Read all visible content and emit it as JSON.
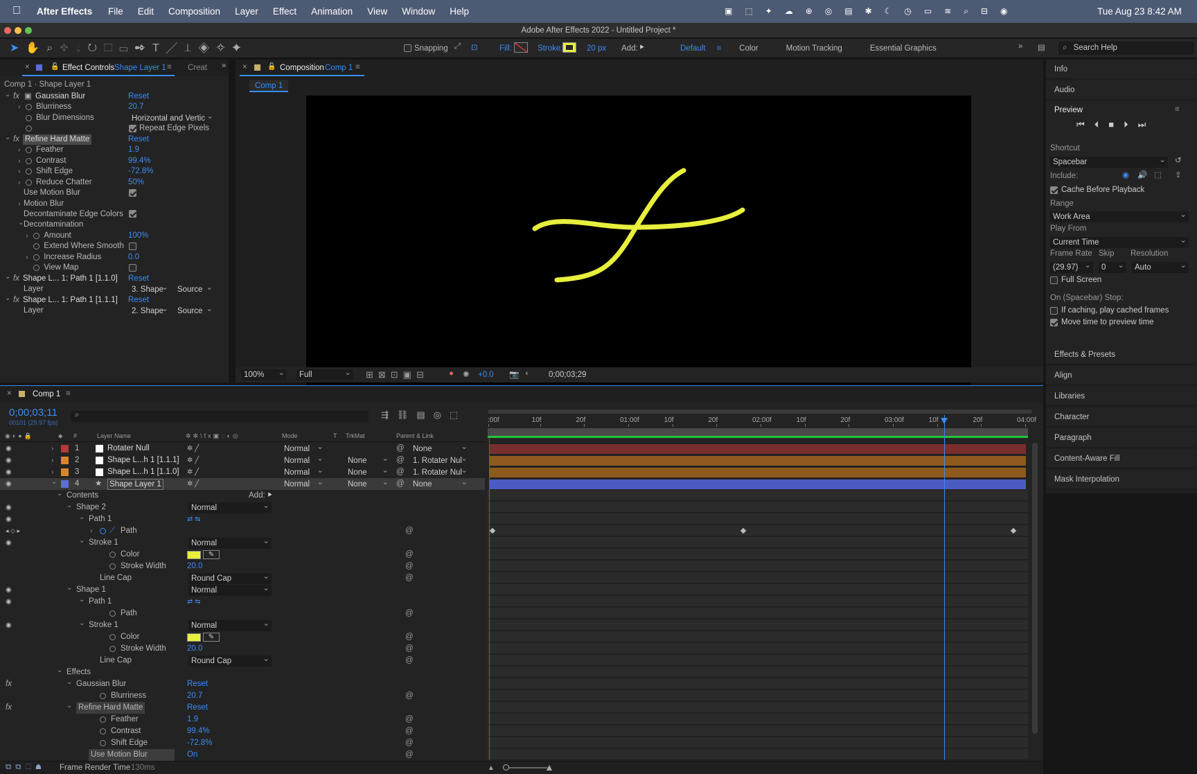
{
  "menubar": {
    "app": "After Effects",
    "items": [
      "File",
      "Edit",
      "Composition",
      "Layer",
      "Effect",
      "Animation",
      "View",
      "Window",
      "Help"
    ],
    "clock": "Tue Aug 23  8:42 AM"
  },
  "window": {
    "title": "Adobe After Effects 2022 - Untitled Project *"
  },
  "toolbar": {
    "snapping": "Snapping",
    "fill": "Fill:",
    "stroke": "Stroke:",
    "stroke_px": "20 px",
    "add": "Add:",
    "workspaces": [
      "Default",
      "Color",
      "Motion Tracking",
      "Essential Graphics"
    ],
    "search": "Search Help"
  },
  "effect_controls": {
    "tab_prefix": "Effect Controls",
    "tab_layer": "Shape Layer 1",
    "tab2": "Creat",
    "header": "Comp 1 · Shape Layer 1",
    "rows": [
      {
        "l": "Gaussian Blur",
        "v": "Reset",
        "t": "fx",
        "i": 0
      },
      {
        "l": "Blurriness",
        "v": "20.7",
        "t": "p",
        "i": 1
      },
      {
        "l": "Blur Dimensions",
        "v": "Horizontal and Vertic",
        "t": "dd",
        "i": 1
      },
      {
        "l": "",
        "v": "Repeat Edge Pixels",
        "t": "cb",
        "i": 1
      },
      {
        "l": "Refine Hard Matte",
        "v": "Reset",
        "t": "fx",
        "i": 0,
        "sel": true
      },
      {
        "l": "Feather",
        "v": "1.9",
        "t": "p",
        "i": 1
      },
      {
        "l": "Contrast",
        "v": "99.4%",
        "t": "p",
        "i": 1
      },
      {
        "l": "Shift Edge",
        "v": "-72.8%",
        "t": "p",
        "i": 1
      },
      {
        "l": "Reduce Chatter",
        "v": "50%",
        "t": "p",
        "i": 1
      },
      {
        "l": "Use Motion Blur",
        "v": "",
        "t": "cb",
        "i": 2
      },
      {
        "l": "Motion Blur",
        "v": "",
        "t": "grp",
        "i": 1
      },
      {
        "l": "Decontaminate Edge Colors",
        "v": "",
        "t": "cb",
        "i": 2
      },
      {
        "l": "Decontamination",
        "v": "",
        "t": "grp",
        "i": 1,
        "open": true
      },
      {
        "l": "Amount",
        "v": "100%",
        "t": "p",
        "i": 2
      },
      {
        "l": "Extend Where Smooth",
        "v": "",
        "t": "cbo",
        "i": 2
      },
      {
        "l": "Increase Radius",
        "v": "0.0",
        "t": "p",
        "i": 2
      },
      {
        "l": "View Map",
        "v": "",
        "t": "cbo",
        "i": 2
      },
      {
        "l": "Shape L... 1: Path 1 [1.1.0]",
        "v": "Reset",
        "t": "fx",
        "i": 0
      },
      {
        "l": "Layer",
        "v": "3. Shape",
        "t": "layer",
        "i": 2,
        "src": "Source"
      },
      {
        "l": "Shape L... 1: Path 1 [1.1.1]",
        "v": "Reset",
        "t": "fx",
        "i": 0
      },
      {
        "l": "Layer",
        "v": "2. Shape",
        "t": "layer",
        "i": 2,
        "src": "Source"
      }
    ]
  },
  "composition": {
    "tab_prefix": "Composition",
    "tab_comp": "Comp 1",
    "subtab": "Comp 1",
    "zoom": "100%",
    "quality": "Full",
    "exposure": "+0.0",
    "timecode": "0;00;03;29"
  },
  "right_panel": {
    "info": "Info",
    "audio": "Audio",
    "preview": "Preview",
    "shortcut_label": "Shortcut",
    "shortcut": "Spacebar",
    "include": "Include:",
    "cache": "Cache Before Playback",
    "range_label": "Range",
    "range": "Work Area",
    "playfrom_label": "Play From",
    "playfrom": "Current Time",
    "framerate_label": "Frame Rate",
    "skip_label": "Skip",
    "resolution_label": "Resolution",
    "framerate": "(29.97)",
    "skip": "0",
    "resolution": "Auto",
    "fullscreen": "Full Screen",
    "onstop": "On (Spacebar) Stop:",
    "ifcaching": "If caching, play cached frames",
    "movetime": "Move time to preview time",
    "panels": [
      "Effects & Presets",
      "Align",
      "Libraries",
      "Character",
      "Paragraph",
      "Content-Aware Fill",
      "Mask Interpolation"
    ]
  },
  "timeline": {
    "tab": "Comp 1",
    "timecode": "0;00;03;11",
    "frames": "00101 (29.97 fps)",
    "col_labels": {
      "layer_name": "Layer Name",
      "mode": "Mode",
      "t": "T",
      "trkmat": "TrkMat",
      "parent": "Parent & Link",
      "num": "#"
    },
    "ruler": [
      ":00f",
      "10f",
      "20f",
      "01:00f",
      "10f",
      "20f",
      "02:00f",
      "10f",
      "20f",
      "03:00f",
      "10f",
      "20f",
      "04:00f"
    ],
    "layers": [
      {
        "num": "1",
        "name": "Rotater Null",
        "mode": "Normal",
        "trk": "",
        "parent": "None",
        "color": "#b33a36",
        "bar": "#7a2f2f"
      },
      {
        "num": "2",
        "name": "Shape L...h 1 [1.1.1]",
        "mode": "Normal",
        "trk": "None",
        "parent": "1. Rotater Nul",
        "color": "#d9862a",
        "bar": "#8f5a1e"
      },
      {
        "num": "3",
        "name": "Shape L...h 1 [1.1.0]",
        "mode": "Normal",
        "trk": "None",
        "parent": "1. Rotater Nul",
        "color": "#d9862a",
        "bar": "#8f5a1e"
      },
      {
        "num": "4",
        "name": "Shape Layer 1",
        "mode": "Normal",
        "trk": "None",
        "parent": "None",
        "color": "#5b6ed8",
        "bar": "#4b5bc4"
      }
    ],
    "props": [
      {
        "l": "Contents",
        "i": 0,
        "x": "Add:"
      },
      {
        "l": "Shape 2",
        "i": 1,
        "m": "Normal"
      },
      {
        "l": "Path 1",
        "i": 2
      },
      {
        "l": "Path",
        "i": 3,
        "key": true
      },
      {
        "l": "Stroke 1",
        "i": 2,
        "m": "Normal"
      },
      {
        "l": "Color",
        "i": 4,
        "sw": true
      },
      {
        "l": "Stroke Width",
        "i": 4,
        "v": "20.0"
      },
      {
        "l": "Line Cap",
        "i": 3,
        "m": "Round Cap"
      },
      {
        "l": "Shape 1",
        "i": 1,
        "m": "Normal"
      },
      {
        "l": "Path 1",
        "i": 2
      },
      {
        "l": "Path",
        "i": 4
      },
      {
        "l": "Stroke 1",
        "i": 2,
        "m": "Normal"
      },
      {
        "l": "Color",
        "i": 4,
        "sw": true
      },
      {
        "l": "Stroke Width",
        "i": 4,
        "v": "20.0"
      },
      {
        "l": "Line Cap",
        "i": 3,
        "m": "Round Cap"
      },
      {
        "l": "Effects",
        "i": 0
      },
      {
        "l": "Gaussian Blur",
        "i": 1,
        "v": "Reset"
      },
      {
        "l": "Blurriness",
        "i": 3,
        "v": "20.7"
      },
      {
        "l": "Refine Hard Matte",
        "i": 1,
        "v": "Reset",
        "sel": true
      },
      {
        "l": "Feather",
        "i": 3,
        "v": "1.9"
      },
      {
        "l": "Contrast",
        "i": 3,
        "v": "99.4%"
      },
      {
        "l": "Shift Edge",
        "i": 3,
        "v": "-72.8%"
      },
      {
        "l": "Use Motion Blur",
        "i": 2,
        "v": "On",
        "sel": true
      }
    ],
    "footer": {
      "render": "Frame Render Time",
      "ms": "130ms"
    },
    "playhead_frac": 0.845
  },
  "colors": {
    "accent": "#3b8cf4",
    "stroke_yellow": "#e8ef3c",
    "green": "#23c23c"
  }
}
